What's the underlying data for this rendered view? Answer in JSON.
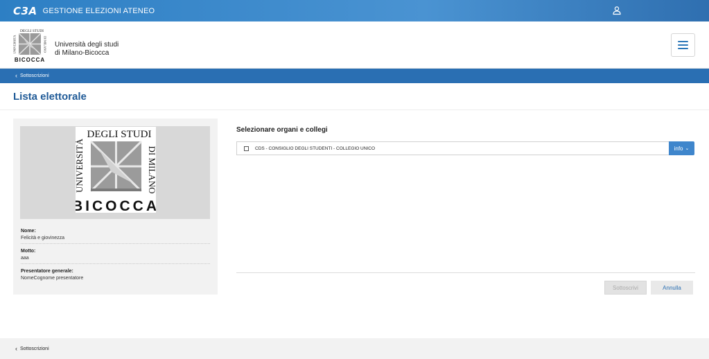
{
  "topbar": {
    "logo_text": "C3A",
    "app_title": "GESTIONE ELEZIONI ATENEO"
  },
  "header": {
    "logo_lines": [
      "UNIVERSITÀ DEGLI STUDI",
      "BICOCCA"
    ],
    "university_line1": "Università degli studi",
    "university_line2": "di Milano-Bicocca"
  },
  "breadcrumb": {
    "label": "Sottoscrizioni"
  },
  "page": {
    "title": "Lista elettorale"
  },
  "card": {
    "logo_top": "DEGLI STUDI",
    "logo_left": "UNIVERSITÀ",
    "logo_right": "DI MILANO",
    "logo_bottom": "BICOCCA",
    "fields": [
      {
        "label": "Nome:",
        "value": "Felicità e giovinezza"
      },
      {
        "label": "Motto:",
        "value": "aaa"
      },
      {
        "label": "Presentatore generale:",
        "value": "NomeCognome presentatore"
      }
    ]
  },
  "selection": {
    "title": "Selezionare organi e collegi",
    "options": [
      {
        "label": "CDS - CONSIGLIO DEGLI STUDENTI - COLLEGIO UNICO",
        "checked": false
      }
    ],
    "info_label": "info"
  },
  "actions": {
    "subscribe_label": "Sottoscrivi",
    "cancel_label": "Annulla"
  },
  "footer": {
    "crumb_label": "Sottoscrizioni"
  },
  "colors": {
    "topbar": "#2d7fc4",
    "crumbbar": "#2a6fb3",
    "title": "#1f5a97",
    "info_button": "#3f86cc"
  },
  "icons": [
    "user-icon",
    "menu-icon",
    "chevron-left-icon",
    "chevron-down-icon",
    "checkbox-icon"
  ]
}
